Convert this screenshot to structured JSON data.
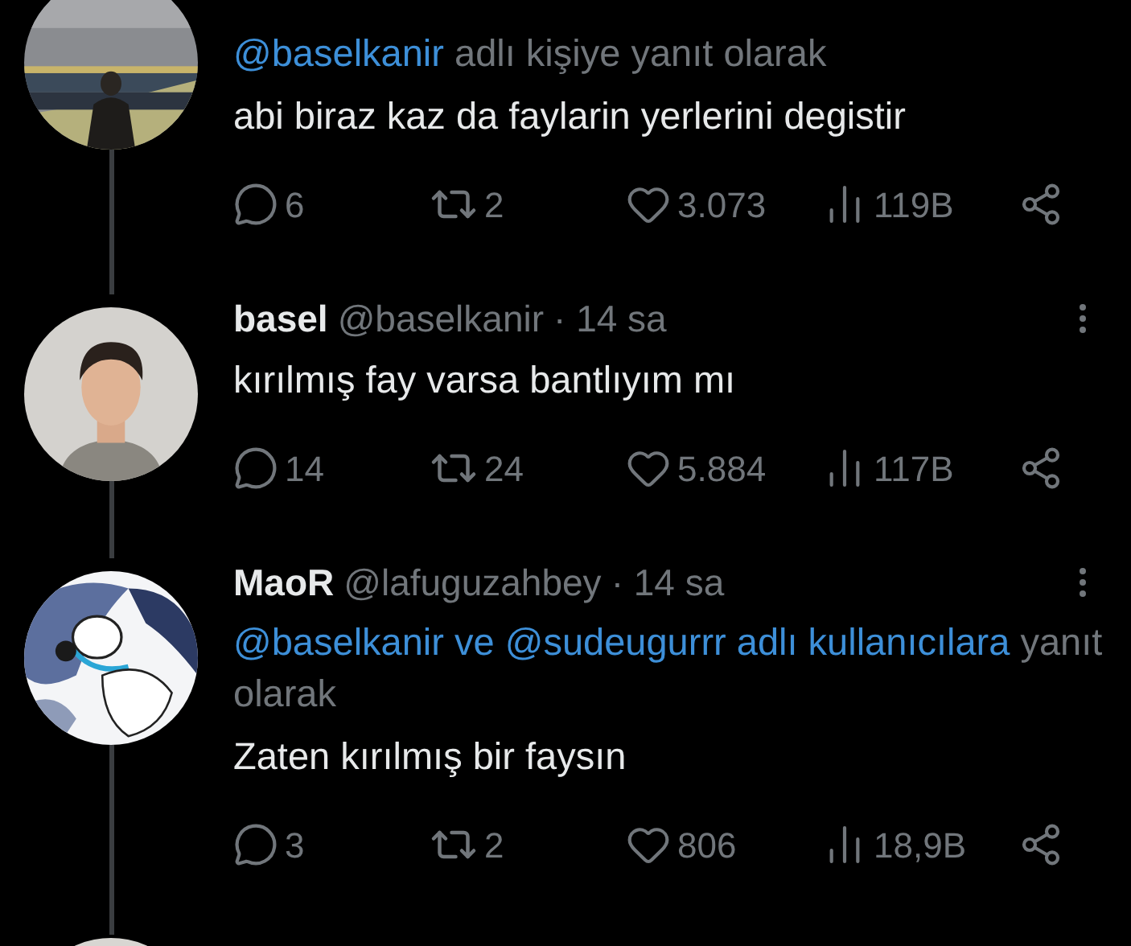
{
  "tweets": [
    {
      "avatar": {
        "kind": "picture"
      },
      "reply": [
        {
          "text": "@baselkanir",
          "link": true
        },
        {
          "text": "adlı kişiye yanıt olarak",
          "link": false
        }
      ],
      "text": "abi biraz kaz da faylarin yerlerini degistir",
      "stats": {
        "replies": "6",
        "retweets": "2",
        "likes": "3.073",
        "views": "119B"
      }
    },
    {
      "avatar": {
        "kind": "picture"
      },
      "name": "basel",
      "handle": "@baselkanir",
      "time": "· 14 sa",
      "text": "kırılmış fay varsa bantlıyım mı",
      "stats": {
        "replies": "14",
        "retweets": "24",
        "likes": "5.884",
        "views": "117B"
      }
    },
    {
      "avatar": {
        "kind": "picture"
      },
      "name": "MaoR",
      "handle": "@lafuguzahbey",
      "time": "· 14 sa",
      "reply": [
        {
          "text": "@baselkanir ve @sudeugurrr adlı kullanıcılara",
          "link": true
        },
        {
          "text": "yanıt olarak",
          "link": false
        }
      ],
      "text": "Zaten kırılmış bir faysın",
      "stats": {
        "replies": "3",
        "retweets": "2",
        "likes": "806",
        "views": "18,9B"
      }
    }
  ]
}
